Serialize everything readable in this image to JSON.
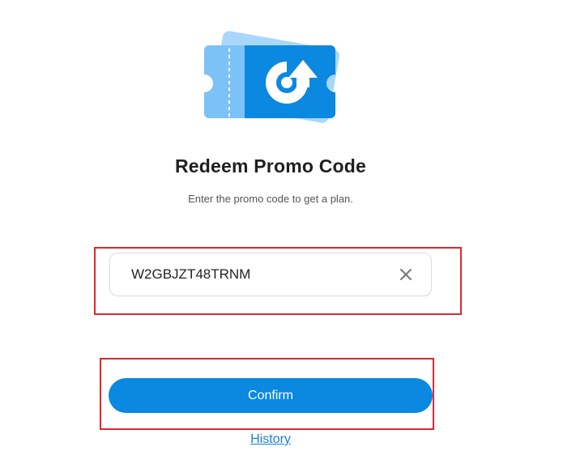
{
  "header": {
    "illustration_icon": "promo-ticket-icon",
    "title": "Redeem Promo Code",
    "subtitle": "Enter the promo code to get a plan."
  },
  "form": {
    "code_value": "W2GBJZT48TRNM",
    "clear_icon": "close-icon",
    "confirm_label": "Confirm"
  },
  "footer": {
    "history_label": "History"
  },
  "colors": {
    "accent": "#0b88e0",
    "highlight": "#e0272f",
    "link": "#1a7fd6"
  }
}
